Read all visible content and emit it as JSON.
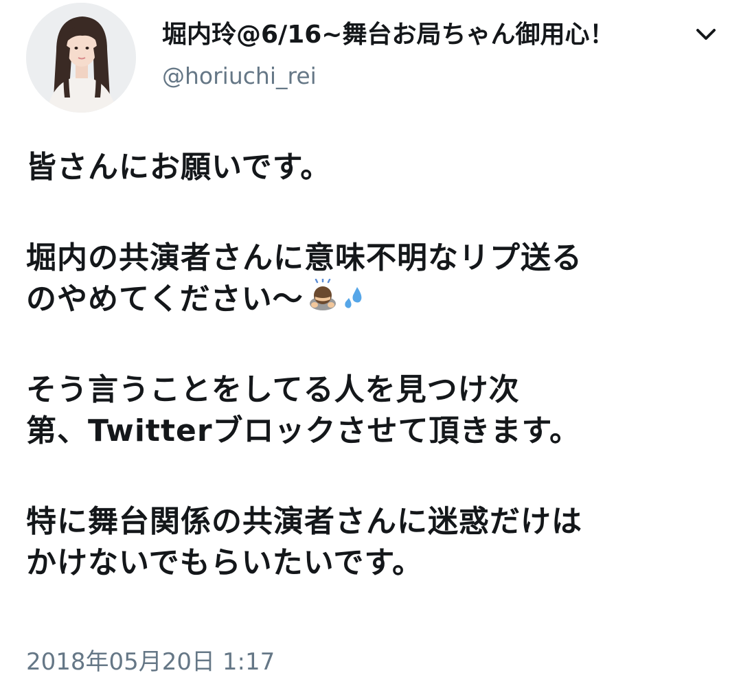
{
  "tweet": {
    "display_name": "堀内玲@6/16~舞台お局ちゃん御用心！",
    "handle": "@horiuchi_rei",
    "paragraphs": [
      [
        "皆さんにお願いです。"
      ],
      [
        "堀内の共演者さんに意味不明なリプ送る",
        "のやめてください〜"
      ],
      [
        "そう言うことをしてる人を見つけ次",
        "第、Twitterブロックさせて頂きます。"
      ],
      [
        "特に舞台関係の共演者さんに迷惑だけは",
        "かけないでもらいたいです。"
      ]
    ],
    "emojis": [
      "person-bowing-icon",
      "sweat-droplets-icon"
    ],
    "timestamp": "2018年05月20日 1:17"
  },
  "colors": {
    "primary_text": "#14171a",
    "secondary_text": "#657786",
    "background": "#ffffff"
  }
}
